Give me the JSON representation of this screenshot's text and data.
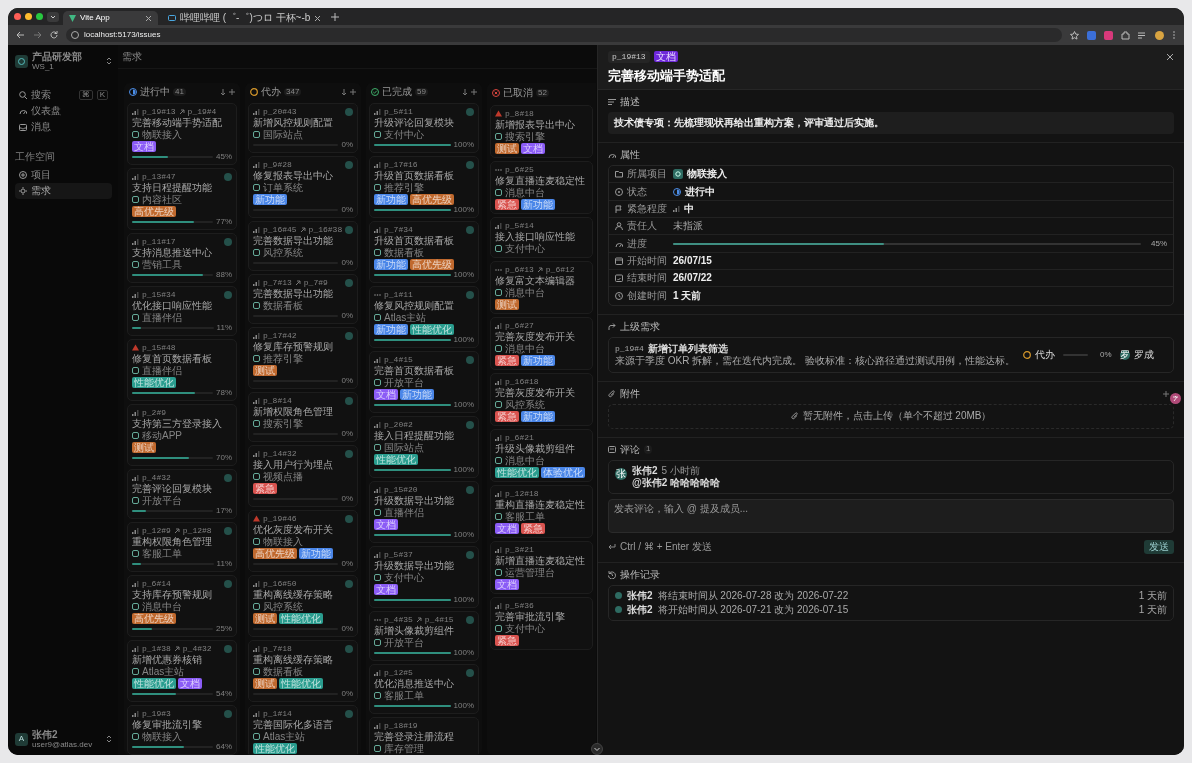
{
  "browser": {
    "tabs": [
      {
        "title": "Vite App",
        "selected": true
      },
      {
        "title": "哔哩哔哩 (゜-゜)つロ 干杯~-b",
        "selected": false
      }
    ],
    "url": "localhost:5173/issues"
  },
  "sidebar": {
    "workspace": {
      "name": "产品研发部",
      "sub": "WS_1"
    },
    "search": {
      "label": "搜索",
      "keys": [
        "⌘",
        "K"
      ]
    },
    "items": [
      {
        "kind": "dashboard",
        "label": "仪表盘",
        "selected": false
      },
      {
        "kind": "inbox",
        "label": "消息",
        "selected": false
      }
    ],
    "section": "工作空间",
    "workspace_items": [
      {
        "kind": "project",
        "label": "项目",
        "selected": false
      },
      {
        "kind": "issue",
        "label": "需求",
        "selected": true
      }
    ],
    "user": {
      "initial": "A",
      "name": "张伟2",
      "email": "user9@atlas.dev"
    }
  },
  "breadcrumb": "需求",
  "board": {
    "columns": [
      {
        "kind": "progress",
        "name": "进行中",
        "count": "41",
        "cards": [
          {
            "kind": "medium",
            "id": "p_19#13",
            "parent": "p_19#4",
            "title": "完善移动端手势适配",
            "project": "物联接入",
            "tags": [
              {
                "label": "文档",
                "color": "#8b5cf6"
              }
            ],
            "level": 0.45,
            "progress": "45%",
            "assigned": false
          },
          {
            "kind": "medium",
            "id": "p_13#47",
            "title": "支持日程提醒功能",
            "project": "内容社区",
            "tags": [
              {
                "label": "高优先级",
                "color": "#c0692e"
              }
            ],
            "level": 0.77,
            "progress": "77%",
            "assigned": true
          },
          {
            "kind": "medium",
            "id": "p_11#17",
            "title": "支持消息推送中心",
            "project": "营销工具",
            "level": 0.88,
            "progress": "88%",
            "assigned": true
          },
          {
            "kind": "medium",
            "id": "p_15#34",
            "title": "优化接口响应性能",
            "project": "直播伴侣",
            "level": 0.11,
            "progress": "11%",
            "assigned": true
          },
          {
            "kind": "urgent",
            "id": "p_15#48",
            "title": "修复首页数据看板",
            "project": "直播伴侣",
            "tags": [
              {
                "label": "性能优化",
                "color": "#2a9d8f"
              }
            ],
            "level": 0.78,
            "progress": "78%",
            "assigned": false
          },
          {
            "kind": "medium",
            "id": "p_2#9",
            "title": "支持第三方登录接入",
            "project": "移动APP",
            "tags": [
              {
                "label": "测试",
                "color": "#c0692e"
              }
            ],
            "level": 0.7,
            "progress": "70%",
            "assigned": false
          },
          {
            "kind": "medium",
            "id": "p_4#32",
            "title": "完善评论回复模块",
            "project": "开放平台",
            "level": 0.17,
            "progress": "17%",
            "assigned": true
          },
          {
            "kind": "medium",
            "id": "p_12#9",
            "parent": "p_12#8",
            "title": "重构权限角色管理",
            "project": "客服工单",
            "level": 0.11,
            "progress": "11%",
            "assigned": true
          },
          {
            "kind": "medium",
            "id": "p_6#14",
            "title": "支持库存预警规则",
            "project": "消息中台",
            "tags": [
              {
                "label": "高优先级",
                "color": "#c0692e"
              }
            ],
            "level": 0.25,
            "progress": "25%",
            "assigned": true
          },
          {
            "kind": "medium",
            "id": "p_1#38",
            "parent": "p_4#32",
            "title": "新增优惠券核销",
            "project": "Atlas主站",
            "tags": [
              {
                "label": "性能优化",
                "color": "#2a9d8f"
              },
              {
                "label": "文档",
                "color": "#8b5cf6"
              }
            ],
            "level": 0.54,
            "progress": "54%",
            "assigned": true
          },
          {
            "kind": "medium",
            "id": "p_19#3",
            "title": "修复审批流引擎",
            "project": "物联接入",
            "level": 0.64,
            "progress": "64%",
            "assigned": true
          }
        ]
      },
      {
        "kind": "todo",
        "name": "代办",
        "count": "347",
        "cards": [
          {
            "kind": "medium",
            "id": "p_20#43",
            "title": "新增风控规则配置",
            "project": "国际站点",
            "level": 0,
            "progress": "0%",
            "assigned": true
          },
          {
            "kind": "medium",
            "id": "p_9#28",
            "title": "修复报表导出中心",
            "project": "订单系统",
            "tags": [
              {
                "label": "新功能",
                "color": "#4a86e8"
              }
            ],
            "level": 0,
            "progress": "0%",
            "assigned": true
          },
          {
            "kind": "medium",
            "id": "p_16#45",
            "parent": "p_16#38",
            "title": "完善数据导出功能",
            "project": "风控系统",
            "level": 0,
            "progress": "0%",
            "assigned": true
          },
          {
            "kind": "medium",
            "id": "p_7#13",
            "parent": "p_7#9",
            "title": "完善数据导出功能",
            "project": "数据看板",
            "level": 0,
            "progress": "0%",
            "assigned": true
          },
          {
            "kind": "medium",
            "id": "p_17#42",
            "title": "修复库存预警规则",
            "project": "推荐引擎",
            "tags": [
              {
                "label": "测试",
                "color": "#c0692e"
              }
            ],
            "level": 0,
            "progress": "0%",
            "assigned": true
          },
          {
            "kind": "medium",
            "id": "p_8#14",
            "title": "新增权限角色管理",
            "project": "搜索引擎",
            "level": 0,
            "progress": "0%",
            "assigned": true
          },
          {
            "kind": "medium",
            "id": "p_14#32",
            "title": "接入用户行为埋点",
            "project": "视频点播",
            "tags": [
              {
                "label": "紧急",
                "color": "#d9534f"
              }
            ],
            "level": 0,
            "progress": "0%",
            "assigned": true
          },
          {
            "kind": "urgent",
            "id": "p_19#46",
            "title": "优化灰度发布开关",
            "project": "物联接入",
            "tags": [
              {
                "label": "高优先级",
                "color": "#c0692e"
              },
              {
                "label": "新功能",
                "color": "#4a86e8"
              }
            ],
            "level": 0,
            "progress": "0%",
            "assigned": true
          },
          {
            "kind": "medium",
            "id": "p_16#50",
            "title": "重构离线缓存策略",
            "project": "风控系统",
            "tags": [
              {
                "label": "测试",
                "color": "#c0692e"
              },
              {
                "label": "性能优化",
                "color": "#2a9d8f"
              }
            ],
            "level": 0,
            "progress": "0%",
            "assigned": true
          },
          {
            "kind": "medium",
            "id": "p_7#18",
            "title": "重构离线缓存策略",
            "project": "数据看板",
            "tags": [
              {
                "label": "测试",
                "color": "#c0692e"
              },
              {
                "label": "性能优化",
                "color": "#2a9d8f"
              }
            ],
            "level": 0,
            "progress": "0%",
            "assigned": true
          },
          {
            "kind": "medium",
            "id": "p_1#14",
            "title": "完善国际化多语言",
            "project": "Atlas主站",
            "tags": [
              {
                "label": "性能优化",
                "color": "#2a9d8f"
              }
            ],
            "assigned": true
          }
        ]
      },
      {
        "kind": "done",
        "name": "已完成",
        "count": "59",
        "cards": [
          {
            "kind": "medium",
            "id": "p_5#11",
            "title": "升级评论回复模块",
            "project": "支付中心",
            "level": 1,
            "progress": "100%",
            "assigned": true
          },
          {
            "kind": "medium",
            "id": "p_17#16",
            "title": "升级首页数据看板",
            "project": "推荐引擎",
            "tags": [
              {
                "label": "新功能",
                "color": "#4a86e8"
              },
              {
                "label": "高优先级",
                "color": "#c0692e"
              }
            ],
            "level": 1,
            "progress": "100%",
            "assigned": true
          },
          {
            "kind": "medium",
            "id": "p_7#34",
            "title": "升级首页数据看板",
            "project": "数据看板",
            "tags": [
              {
                "label": "新功能",
                "color": "#4a86e8"
              },
              {
                "label": "高优先级",
                "color": "#c0692e"
              }
            ],
            "level": 1,
            "progress": "100%",
            "assigned": true
          },
          {
            "kind": "none",
            "id": "p_1#11",
            "title": "修复风控规则配置",
            "project": "Atlas主站",
            "tags": [
              {
                "label": "新功能",
                "color": "#4a86e8"
              },
              {
                "label": "性能优化",
                "color": "#2a9d8f"
              }
            ],
            "level": 1,
            "progress": "100%",
            "assigned": true
          },
          {
            "kind": "medium",
            "id": "p_4#15",
            "title": "完善首页数据看板",
            "project": "开放平台",
            "tags": [
              {
                "label": "文档",
                "color": "#8b5cf6"
              },
              {
                "label": "新功能",
                "color": "#4a86e8"
              }
            ],
            "level": 1,
            "progress": "100%",
            "assigned": true
          },
          {
            "kind": "medium",
            "id": "p_20#2",
            "title": "接入日程提醒功能",
            "project": "国际站点",
            "tags": [
              {
                "label": "性能优化",
                "color": "#2a9d8f"
              }
            ],
            "level": 1,
            "progress": "100%",
            "assigned": true
          },
          {
            "kind": "medium",
            "id": "p_15#20",
            "title": "升级数据导出功能",
            "project": "直播伴侣",
            "tags": [
              {
                "label": "文档",
                "color": "#8b5cf6"
              }
            ],
            "level": 1,
            "progress": "100%",
            "assigned": true
          },
          {
            "kind": "medium",
            "id": "p_5#37",
            "title": "升级数据导出功能",
            "project": "支付中心",
            "tags": [
              {
                "label": "文档",
                "color": "#8b5cf6"
              }
            ],
            "level": 1,
            "progress": "100%",
            "assigned": true
          },
          {
            "kind": "none",
            "id": "p_4#35",
            "parent": "p_4#15",
            "title": "新增头像裁剪组件",
            "project": "开放平台",
            "level": 1,
            "progress": "100%",
            "assigned": true
          },
          {
            "kind": "medium",
            "id": "p_12#5",
            "title": "优化消息推送中心",
            "project": "客服工单",
            "level": 1,
            "progress": "100%",
            "assigned": true
          },
          {
            "kind": "medium",
            "id": "p_18#19",
            "title": "完善登录注册流程",
            "project": "库存管理",
            "assigned": false
          }
        ]
      },
      {
        "kind": "cancelled",
        "name": "已取消",
        "count": "52",
        "cards": [
          {
            "kind": "urgent",
            "id": "p_8#18",
            "title": "新增报表导出中心",
            "project": "搜索引擎",
            "tags": [
              {
                "label": "测试",
                "color": "#c0692e"
              },
              {
                "label": "文档",
                "color": "#8b5cf6"
              }
            ]
          },
          {
            "kind": "none",
            "id": "p_6#25",
            "title": "修复直播连麦稳定性",
            "project": "消息中台",
            "tags": [
              {
                "label": "紧急",
                "color": "#d9534f"
              },
              {
                "label": "新功能",
                "color": "#4a86e8"
              }
            ]
          },
          {
            "kind": "medium",
            "id": "p_5#14",
            "title": "接入接口响应性能",
            "project": "支付中心"
          },
          {
            "kind": "none",
            "id": "p_6#13",
            "parent": "p_6#12",
            "title": "修复富文本编辑器",
            "project": "消息中台",
            "tags": [
              {
                "label": "测试",
                "color": "#c0692e"
              }
            ]
          },
          {
            "kind": "medium",
            "id": "p_6#27",
            "title": "完善灰度发布开关",
            "project": "消息中台",
            "tags": [
              {
                "label": "紧急",
                "color": "#d9534f"
              },
              {
                "label": "新功能",
                "color": "#4a86e8"
              }
            ]
          },
          {
            "kind": "medium",
            "id": "p_16#18",
            "title": "完善灰度发布开关",
            "project": "风控系统",
            "tags": [
              {
                "label": "紧急",
                "color": "#d9534f"
              },
              {
                "label": "新功能",
                "color": "#4a86e8"
              }
            ]
          },
          {
            "kind": "medium",
            "id": "p_6#21",
            "title": "升级头像裁剪组件",
            "project": "消息中台",
            "tags": [
              {
                "label": "性能优化",
                "color": "#2a9d8f"
              },
              {
                "label": "体验优化",
                "color": "#4a86e8"
              }
            ]
          },
          {
            "kind": "medium",
            "id": "p_12#18",
            "title": "重构直播连麦稳定性",
            "project": "客服工单",
            "tags": [
              {
                "label": "文档",
                "color": "#8b5cf6"
              },
              {
                "label": "紧急",
                "color": "#d9534f"
              }
            ]
          },
          {
            "kind": "medium",
            "id": "p_3#21",
            "title": "新增直播连麦稳定性",
            "project": "运营管理台",
            "tags": [
              {
                "label": "文档",
                "color": "#8b5cf6"
              }
            ]
          },
          {
            "kind": "medium",
            "id": "p_5#36",
            "title": "完善审批流引擎",
            "project": "支付中心",
            "tags": [
              {
                "label": "紧急",
                "color": "#d9534f"
              }
            ]
          }
        ]
      }
    ]
  },
  "detail": {
    "id": "p_19#13",
    "tag": {
      "label": "文档",
      "color": "#6d28d9"
    },
    "title": "完善移动端手势适配",
    "description_label": "描述",
    "description": "技术债专项：先梳理现状再给出重构方案，评审通过后实施。",
    "properties_label": "属性",
    "properties": [
      {
        "kind": "project",
        "label": "所属项目",
        "value": "物联接入"
      },
      {
        "kind": "status",
        "label": "状态",
        "value": "进行中"
      },
      {
        "kind": "priority",
        "label": "紧急程度",
        "value": "中"
      },
      {
        "kind": "assignee",
        "label": "责任人",
        "value": "未指派"
      },
      {
        "kind": "progress",
        "label": "进度",
        "level": 0.45,
        "reading": "45%"
      },
      {
        "kind": "start",
        "label": "开始时间",
        "value": "26/07/15"
      },
      {
        "kind": "end",
        "label": "结束时间",
        "value": "26/07/22"
      },
      {
        "kind": "created",
        "label": "创建时间",
        "value": "1 天前"
      }
    ],
    "parent": {
      "label": "上级需求",
      "id": "p_19#4",
      "title": "新增订单列表筛选",
      "description": "来源于季度 OKR 拆解，需在迭代内完成。 验收标准：核心路径通过测试用例，性能达标。",
      "status": "代办",
      "level": 0,
      "reading": "0%",
      "assignee_initial": "罗",
      "assignee": "罗成"
    },
    "attachments": {
      "label": "附件",
      "empty": "暂无附件，点击上传（单个不超过 20MB）"
    },
    "comments": {
      "label": "评论",
      "count": "1",
      "items": [
        {
          "initial": "张",
          "author": "张伟2",
          "time": "5 小时前",
          "text": "@张伟2  哈哈哈哈哈"
        }
      ],
      "placeholder": "发表评论，输入 @ 提及成员...",
      "hint": "Ctrl / ⌘ + Enter 发送",
      "send": "发送"
    },
    "history": {
      "label": "操作记录",
      "items": [
        {
          "author": "张伟2",
          "text": "将结束时间从 2026-07-28 改为 2026-07-22",
          "time": "1 天前"
        },
        {
          "author": "张伟2",
          "text": "将开始时间从 2026-07-21 改为 2026-07-15",
          "time": "1 天前"
        }
      ]
    }
  }
}
